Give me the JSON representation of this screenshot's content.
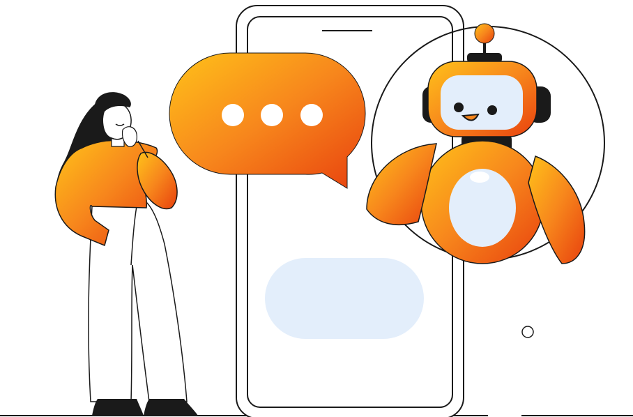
{
  "illustration": {
    "subject": "chatbot-conversation",
    "colors": {
      "accent_start": "#FFC21A",
      "accent_mid": "#F7861C",
      "accent_end": "#E8410E",
      "outline": "#1A1A1A",
      "bubble_light": "#E3EEFB",
      "robot_face": "#E3EEFB",
      "background": "#FFFFFF"
    },
    "icons": [
      "woman-character",
      "phone-outline",
      "speech-bubble-typing",
      "robot-character",
      "reply-bubble",
      "small-circle"
    ]
  }
}
